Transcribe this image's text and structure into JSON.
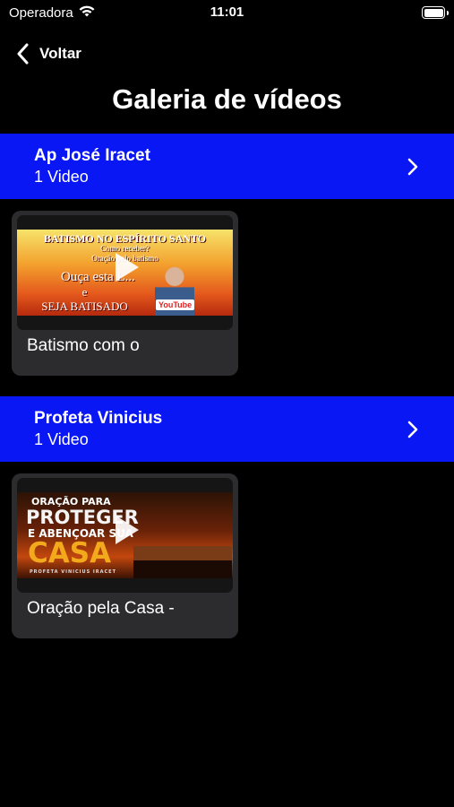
{
  "status_bar": {
    "carrier": "Operadora",
    "time": "11:01"
  },
  "nav": {
    "back_label": "Voltar"
  },
  "page": {
    "title": "Galeria de vídeos"
  },
  "colors": {
    "section_bg": "#0a17f5",
    "card_bg": "#2c2c2e",
    "page_bg": "#000000"
  },
  "sections": [
    {
      "name": "Ap José Iracet",
      "count": "1 Video",
      "videos": [
        {
          "title": "Batismo com o",
          "thumbnail_text": [
            "BATISMO NO ESPÍRITO SANTO",
            "Como receber?",
            "Oração pelo batismo",
            "Ouça esta L...",
            "e",
            "SEJA BATISADO",
            "YouTube"
          ]
        }
      ]
    },
    {
      "name": "Profeta Vinicius",
      "count": "1 Video",
      "videos": [
        {
          "title": "Oração pela Casa -",
          "thumbnail_text": [
            "ORAÇÃO PARA",
            "PROTEGER",
            "E ABENÇOAR SUA",
            "CASA",
            "PROFETA VINICIUS IRACET"
          ]
        }
      ]
    }
  ]
}
